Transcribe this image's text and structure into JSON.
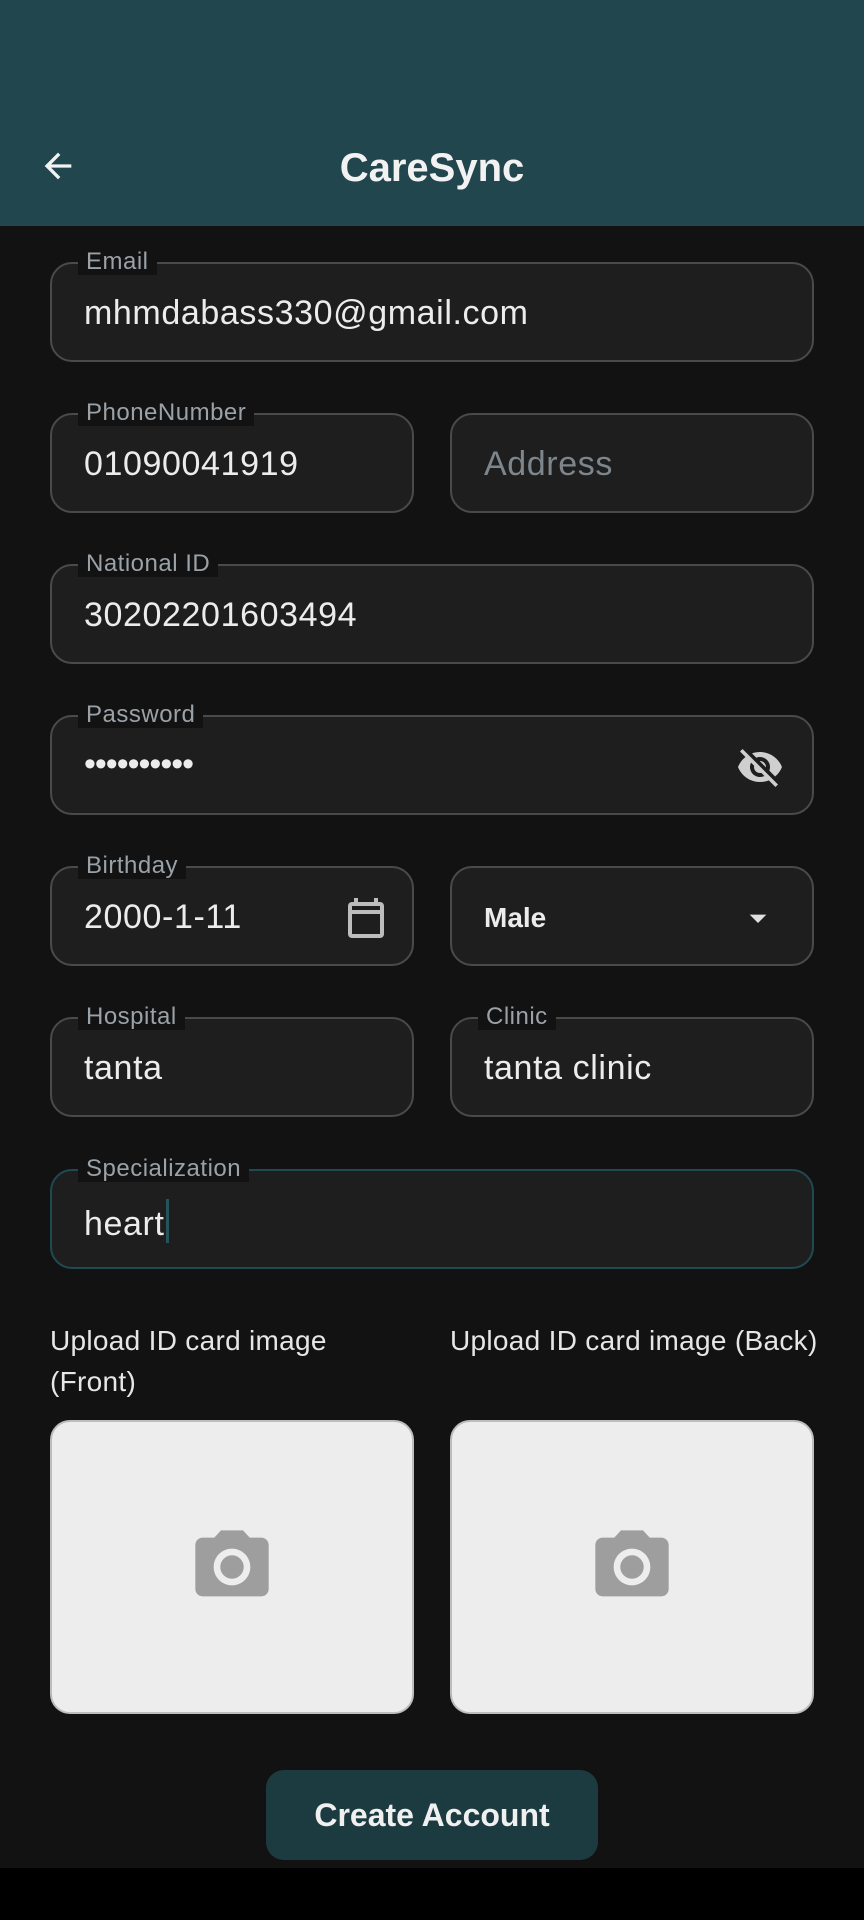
{
  "appbar": {
    "title": "CareSync",
    "back_icon": "arrow-left-icon",
    "background": "#21464e"
  },
  "form": {
    "email": {
      "label": "Email",
      "value": "mhmdabass330@gmail.com"
    },
    "phone": {
      "label": "PhoneNumber",
      "value": "01090041919"
    },
    "address": {
      "placeholder": "Address",
      "value": ""
    },
    "national_id": {
      "label": "National ID",
      "value": "30202201603494"
    },
    "password": {
      "label": "Password",
      "value": "••••••••••",
      "visibility_icon": "eye-off-icon"
    },
    "birthday": {
      "label": "Birthday",
      "value": "2000-1-11",
      "icon": "calendar-icon"
    },
    "gender": {
      "selected": "Male",
      "icon": "dropdown-arrow-icon"
    },
    "hospital": {
      "label": "Hospital",
      "value": "tanta"
    },
    "clinic": {
      "label": "Clinic",
      "value": "tanta clinic"
    },
    "specialization": {
      "label": "Specialization",
      "value": "heart",
      "focused": true
    }
  },
  "uploads": {
    "front": {
      "label": "Upload ID card image (Front)",
      "icon": "camera-icon"
    },
    "back": {
      "label": "Upload ID card image (Back)",
      "icon": "camera-icon"
    }
  },
  "actions": {
    "create_label": "Create Account",
    "button_color": "#1c3b40"
  }
}
